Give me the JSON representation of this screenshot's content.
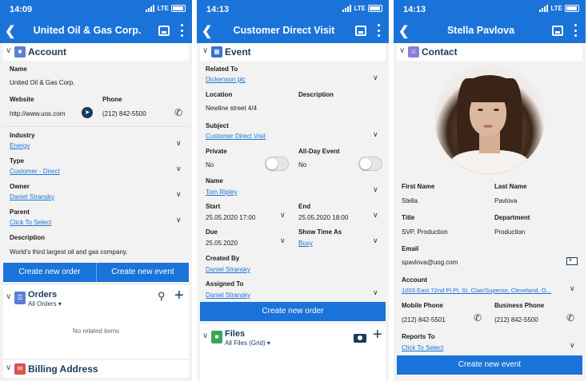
{
  "screens": [
    {
      "status_time": "14:09",
      "network": "LTE",
      "title": "United Oil & Gas Corp.",
      "section_account": "Account",
      "name_label": "Name",
      "name_value": "United Oil & Gas Corp.",
      "website_label": "Website",
      "website_value": "http://www.uos.com",
      "phone_label": "Phone",
      "phone_value": "(212) 842-5500",
      "industry_label": "Industry",
      "industry_value": "Energy",
      "type_label": "Type",
      "type_value": "Customer - Direct",
      "owner_label": "Owner",
      "owner_value": "Daniel Stransky",
      "parent_label": "Parent",
      "parent_value": "Click To Select",
      "description_label": "Description",
      "description_value": "World's third largest oil and gas company.",
      "btn_order": "Create new order",
      "btn_event": "Create new event",
      "orders_title": "Orders",
      "orders_filter": "All Orders",
      "no_related": "No related items",
      "billing_title": "Billing Address"
    },
    {
      "status_time": "14:13",
      "network": "LTE",
      "title": "Customer Direct Visit",
      "section_event": "Event",
      "related_label": "Related To",
      "related_value": "Dickenson plc",
      "location_label": "Location",
      "location_value": "Newline street 4/4",
      "description_label": "Description",
      "subject_label": "Subject",
      "subject_value": "Customer Direct Visit",
      "private_label": "Private",
      "private_value": "No",
      "allday_label": "All-Day Event",
      "allday_value": "No",
      "name_label": "Name",
      "name_value": "Tom Ripley",
      "start_label": "Start",
      "start_value": "25.05.2020 17:00",
      "end_label": "End",
      "end_value": "25.05.2020 18:00",
      "due_label": "Due",
      "due_value": "25.05.2020",
      "showtime_label": "Show Time As",
      "showtime_value": "Busy",
      "createdby_label": "Created By",
      "createdby_value": "Daniel Stransky",
      "assigned_label": "Assigned To",
      "assigned_value": "Daniel Stransky",
      "btn_order": "Create new order",
      "files_title": "Files",
      "files_filter": "All Files (Grid)"
    },
    {
      "status_time": "14:13",
      "network": "LTE",
      "title": "Stella Pavlova",
      "section_contact": "Contact",
      "firstname_label": "First Name",
      "firstname_value": "Stella",
      "lastname_label": "Last Name",
      "lastname_value": "Pavlova",
      "title_label": "Title",
      "title_value": "SVP, Production",
      "department_label": "Department",
      "department_value": "Production",
      "email_label": "Email",
      "email_value": "spavlova@uog.com",
      "account_label": "Account",
      "account_value": "1003 East 72nd Pl Pl. St. Clair/Superior, Cleveland, O...",
      "mobile_label": "Mobile Phone",
      "mobile_value": "(212) 842-5501",
      "business_label": "Business Phone",
      "business_value": "(212) 842-5500",
      "reports_label": "Reports To",
      "reports_value": "Click To Select",
      "btn_event": "Create new event"
    }
  ],
  "colors": {
    "primary": "#1a73d9",
    "section_title": "#1a3a5c",
    "account_icon": "#5b7fd6",
    "event_icon": "#3b6fd1",
    "contact_icon": "#8a7fd8",
    "files_icon": "#3aa657",
    "billing_icon": "#d9534f"
  },
  "icons": [
    "back-chevron-icon",
    "save-icon",
    "more-vertical-icon",
    "compass-icon",
    "phone-icon",
    "chevron-down-icon",
    "location-pin-icon",
    "plus-icon",
    "camera-icon",
    "mail-icon"
  ]
}
